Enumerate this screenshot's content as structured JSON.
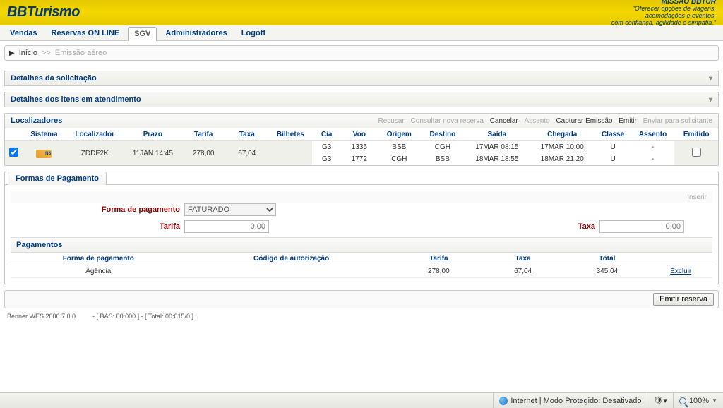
{
  "header": {
    "logo_part1": "BB",
    "logo_part2": "Turismo",
    "mission_title": "MISSÃO BBTUR",
    "mission_line1": "\"Oferecer opções de viagens,",
    "mission_line2": "acomodações e eventos,",
    "mission_line3": "com confiança, agilidade e simpatia.\""
  },
  "menu": {
    "items": [
      "Vendas",
      "Reservas ON LINE",
      "SGV",
      "Administradores",
      "Logoff"
    ],
    "selected_index": 2
  },
  "breadcrumb": {
    "home": "Início",
    "sep": ">>",
    "current": "Emissão aéreo"
  },
  "panels": {
    "detalhes_sol": "Detalhes da solicitação",
    "detalhes_itens": "Detalhes dos itens em atendimento"
  },
  "localizadores": {
    "title": "Localizadores",
    "actions": {
      "recusar": "Recusar",
      "consultar": "Consultar nova reserva",
      "cancelar": "Cancelar",
      "assento": "Assento",
      "capturar": "Capturar Emissão",
      "emitir": "Emitir",
      "enviar": "Enviar para solicitante"
    },
    "columns": [
      "",
      "Sistema",
      "Localizador",
      "Prazo",
      "Tarifa",
      "Taxa",
      "Bilhetes",
      "Cia",
      "Voo",
      "Origem",
      "Destino",
      "Saída",
      "Chegada",
      "Classe",
      "Assento",
      "Emitido"
    ],
    "record": {
      "checked": true,
      "sistema_badge": "NS",
      "localizador": "ZDDF2K",
      "prazo": "11JAN 14:45",
      "tarifa": "278,00",
      "taxa": "67,04",
      "bilhetes": ""
    },
    "flights": [
      {
        "cia": "G3",
        "voo": "1335",
        "origem": "BSB",
        "destino": "CGH",
        "saida": "17MAR 08:15",
        "chegada": "17MAR 10:00",
        "classe": "U",
        "assento": "-",
        "emitido": false
      },
      {
        "cia": "G3",
        "voo": "1772",
        "origem": "CGH",
        "destino": "BSB",
        "saida": "18MAR 18:55",
        "chegada": "18MAR 21:20",
        "classe": "U",
        "assento": "-",
        "emitido": false
      }
    ]
  },
  "formas_pagamento": {
    "tab_label": "Formas de Pagamento",
    "inserir_label": "Inserir",
    "forma_label": "Forma de pagamento",
    "forma_value": "FATURADO",
    "tarifa_label": "Tarifa",
    "tarifa_placeholder": "0,00",
    "taxa_label": "Taxa",
    "taxa_placeholder": "0,00"
  },
  "pagamentos": {
    "title": "Pagamentos",
    "columns": [
      "Forma de pagamento",
      "Código de autorização",
      "Tarifa",
      "Taxa",
      "Total",
      ""
    ],
    "row": {
      "forma": "Agência",
      "codigo": "",
      "tarifa": "278,00",
      "taxa": "67,04",
      "total": "345,04",
      "excluir": "Excluir"
    }
  },
  "emit_button": "Emitir reserva",
  "footer": {
    "app": "Benner WES 2006.7.0.0",
    "stats": "- [ BAS: 00:000 ] - [ Total: 00:015/0 ] ."
  },
  "statusbar": {
    "internet": "Internet | Modo Protegido: Desativado",
    "zoom": "100%"
  }
}
